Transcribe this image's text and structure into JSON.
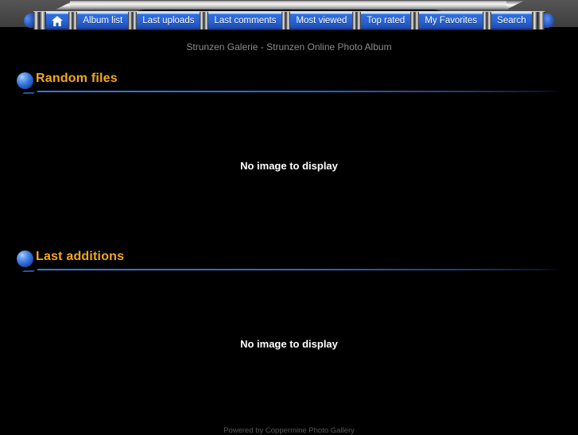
{
  "page": {
    "background_color": "#000000",
    "subtitle": "Strunzen Galerie - Strunzen Online Photo Album"
  },
  "nav": {
    "home_icon": "home-icon",
    "items": [
      {
        "label": "Album list"
      },
      {
        "label": "Last uploads"
      },
      {
        "label": "Last comments"
      },
      {
        "label": "Most viewed"
      },
      {
        "label": "Top rated"
      },
      {
        "label": "My Favorites"
      },
      {
        "label": "Search"
      }
    ],
    "button_color": "#2a63d4",
    "button_text_color": "#ffffff"
  },
  "sections": [
    {
      "bullet_icon": "blue-sphere-bullet-icon",
      "title": "Random files",
      "empty_message": "No image to display"
    },
    {
      "bullet_icon": "blue-sphere-bullet-icon",
      "title": "Last additions",
      "empty_message": "No image to display"
    }
  ],
  "theme": {
    "title_color": "#f3a81e",
    "rule_color": "#3c76d8",
    "subtitle_color": "#8b8b8b",
    "footer_color": "#5a5a5a"
  },
  "footer": {
    "text": "Powered by Coppermine Photo Gallery"
  }
}
